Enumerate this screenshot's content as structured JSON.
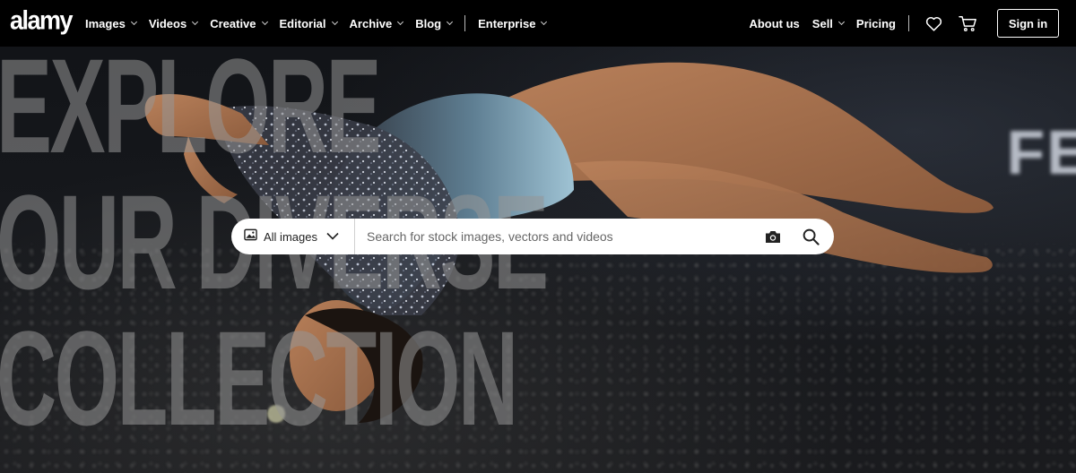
{
  "brand": {
    "logo_text": "alamy"
  },
  "nav": {
    "left_items": [
      {
        "label": "Images"
      },
      {
        "label": "Videos"
      },
      {
        "label": "Creative"
      },
      {
        "label": "Editorial"
      },
      {
        "label": "Archive"
      },
      {
        "label": "Blog"
      }
    ],
    "enterprise": {
      "label": "Enterprise"
    },
    "right_items": {
      "about": "About us",
      "sell": "Sell",
      "pricing": "Pricing"
    },
    "icons": {
      "favorites": "heart-icon",
      "cart": "cart-icon"
    },
    "sign_in": "Sign in"
  },
  "hero": {
    "headline_lines": [
      "Explore",
      "our diverse",
      "collection"
    ],
    "background_sign": "FE"
  },
  "search": {
    "scope": {
      "label": "All images",
      "icon": "image-icon"
    },
    "placeholder": "Search for stock images, vectors and videos",
    "value": "",
    "icons": {
      "visual_search": "camera-icon",
      "submit": "search-icon"
    }
  },
  "colors": {
    "nav_bg": "#000000",
    "text": "#ffffff",
    "headline_overlay": "#969696",
    "search_bg": "#ffffff"
  }
}
